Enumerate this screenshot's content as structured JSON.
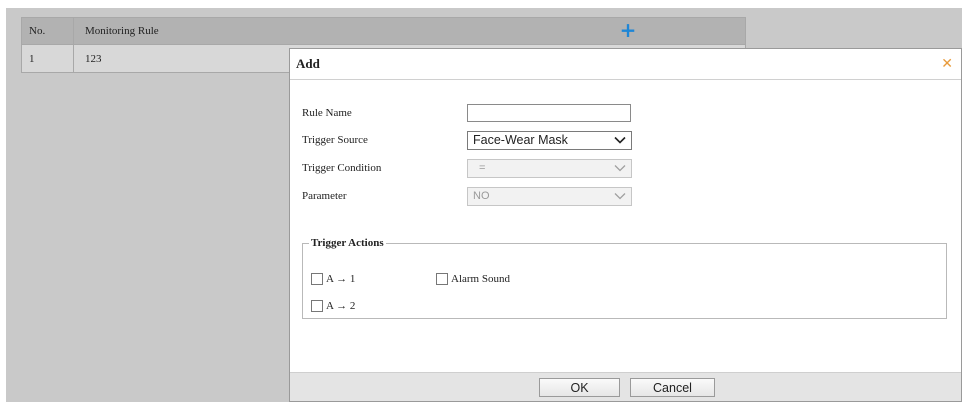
{
  "table": {
    "headers": {
      "no": "No.",
      "rule": "Monitoring Rule"
    },
    "rows": [
      {
        "no": "1",
        "rule": "123"
      }
    ],
    "add_icon": "plus-icon"
  },
  "dialog": {
    "title": "Add",
    "close_icon": "close-icon",
    "fields": {
      "rule_name": {
        "label": "Rule Name",
        "value": ""
      },
      "trigger_source": {
        "label": "Trigger Source",
        "value": "Face-Wear Mask"
      },
      "trigger_condition": {
        "label": "Trigger Condition",
        "value": "="
      },
      "parameter": {
        "label": "Parameter",
        "value": "NO"
      }
    },
    "trigger_actions": {
      "legend": "Trigger Actions",
      "items": [
        {
          "label": "A → 1",
          "checked": false
        },
        {
          "label": "Alarm Sound",
          "checked": false
        },
        {
          "label": "A → 2",
          "checked": false
        }
      ]
    },
    "buttons": {
      "ok": "OK",
      "cancel": "Cancel"
    }
  },
  "colors": {
    "accent": "#1e86d6",
    "close": "#e89a3a",
    "overlay": "#c9c9c9"
  }
}
